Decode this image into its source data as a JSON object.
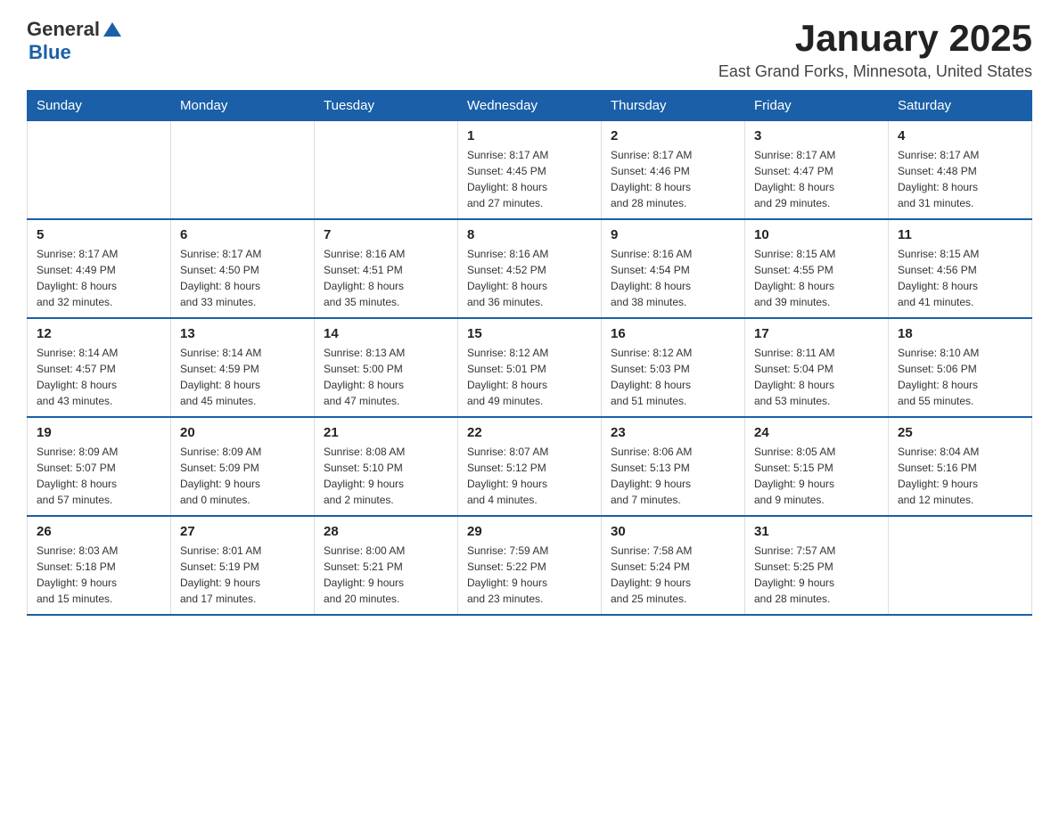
{
  "logo": {
    "general": "General",
    "blue": "Blue"
  },
  "header": {
    "title": "January 2025",
    "location": "East Grand Forks, Minnesota, United States"
  },
  "days_of_week": [
    "Sunday",
    "Monday",
    "Tuesday",
    "Wednesday",
    "Thursday",
    "Friday",
    "Saturday"
  ],
  "weeks": [
    [
      {
        "day": "",
        "info": ""
      },
      {
        "day": "",
        "info": ""
      },
      {
        "day": "",
        "info": ""
      },
      {
        "day": "1",
        "info": "Sunrise: 8:17 AM\nSunset: 4:45 PM\nDaylight: 8 hours\nand 27 minutes."
      },
      {
        "day": "2",
        "info": "Sunrise: 8:17 AM\nSunset: 4:46 PM\nDaylight: 8 hours\nand 28 minutes."
      },
      {
        "day": "3",
        "info": "Sunrise: 8:17 AM\nSunset: 4:47 PM\nDaylight: 8 hours\nand 29 minutes."
      },
      {
        "day": "4",
        "info": "Sunrise: 8:17 AM\nSunset: 4:48 PM\nDaylight: 8 hours\nand 31 minutes."
      }
    ],
    [
      {
        "day": "5",
        "info": "Sunrise: 8:17 AM\nSunset: 4:49 PM\nDaylight: 8 hours\nand 32 minutes."
      },
      {
        "day": "6",
        "info": "Sunrise: 8:17 AM\nSunset: 4:50 PM\nDaylight: 8 hours\nand 33 minutes."
      },
      {
        "day": "7",
        "info": "Sunrise: 8:16 AM\nSunset: 4:51 PM\nDaylight: 8 hours\nand 35 minutes."
      },
      {
        "day": "8",
        "info": "Sunrise: 8:16 AM\nSunset: 4:52 PM\nDaylight: 8 hours\nand 36 minutes."
      },
      {
        "day": "9",
        "info": "Sunrise: 8:16 AM\nSunset: 4:54 PM\nDaylight: 8 hours\nand 38 minutes."
      },
      {
        "day": "10",
        "info": "Sunrise: 8:15 AM\nSunset: 4:55 PM\nDaylight: 8 hours\nand 39 minutes."
      },
      {
        "day": "11",
        "info": "Sunrise: 8:15 AM\nSunset: 4:56 PM\nDaylight: 8 hours\nand 41 minutes."
      }
    ],
    [
      {
        "day": "12",
        "info": "Sunrise: 8:14 AM\nSunset: 4:57 PM\nDaylight: 8 hours\nand 43 minutes."
      },
      {
        "day": "13",
        "info": "Sunrise: 8:14 AM\nSunset: 4:59 PM\nDaylight: 8 hours\nand 45 minutes."
      },
      {
        "day": "14",
        "info": "Sunrise: 8:13 AM\nSunset: 5:00 PM\nDaylight: 8 hours\nand 47 minutes."
      },
      {
        "day": "15",
        "info": "Sunrise: 8:12 AM\nSunset: 5:01 PM\nDaylight: 8 hours\nand 49 minutes."
      },
      {
        "day": "16",
        "info": "Sunrise: 8:12 AM\nSunset: 5:03 PM\nDaylight: 8 hours\nand 51 minutes."
      },
      {
        "day": "17",
        "info": "Sunrise: 8:11 AM\nSunset: 5:04 PM\nDaylight: 8 hours\nand 53 minutes."
      },
      {
        "day": "18",
        "info": "Sunrise: 8:10 AM\nSunset: 5:06 PM\nDaylight: 8 hours\nand 55 minutes."
      }
    ],
    [
      {
        "day": "19",
        "info": "Sunrise: 8:09 AM\nSunset: 5:07 PM\nDaylight: 8 hours\nand 57 minutes."
      },
      {
        "day": "20",
        "info": "Sunrise: 8:09 AM\nSunset: 5:09 PM\nDaylight: 9 hours\nand 0 minutes."
      },
      {
        "day": "21",
        "info": "Sunrise: 8:08 AM\nSunset: 5:10 PM\nDaylight: 9 hours\nand 2 minutes."
      },
      {
        "day": "22",
        "info": "Sunrise: 8:07 AM\nSunset: 5:12 PM\nDaylight: 9 hours\nand 4 minutes."
      },
      {
        "day": "23",
        "info": "Sunrise: 8:06 AM\nSunset: 5:13 PM\nDaylight: 9 hours\nand 7 minutes."
      },
      {
        "day": "24",
        "info": "Sunrise: 8:05 AM\nSunset: 5:15 PM\nDaylight: 9 hours\nand 9 minutes."
      },
      {
        "day": "25",
        "info": "Sunrise: 8:04 AM\nSunset: 5:16 PM\nDaylight: 9 hours\nand 12 minutes."
      }
    ],
    [
      {
        "day": "26",
        "info": "Sunrise: 8:03 AM\nSunset: 5:18 PM\nDaylight: 9 hours\nand 15 minutes."
      },
      {
        "day": "27",
        "info": "Sunrise: 8:01 AM\nSunset: 5:19 PM\nDaylight: 9 hours\nand 17 minutes."
      },
      {
        "day": "28",
        "info": "Sunrise: 8:00 AM\nSunset: 5:21 PM\nDaylight: 9 hours\nand 20 minutes."
      },
      {
        "day": "29",
        "info": "Sunrise: 7:59 AM\nSunset: 5:22 PM\nDaylight: 9 hours\nand 23 minutes."
      },
      {
        "day": "30",
        "info": "Sunrise: 7:58 AM\nSunset: 5:24 PM\nDaylight: 9 hours\nand 25 minutes."
      },
      {
        "day": "31",
        "info": "Sunrise: 7:57 AM\nSunset: 5:25 PM\nDaylight: 9 hours\nand 28 minutes."
      },
      {
        "day": "",
        "info": ""
      }
    ]
  ]
}
